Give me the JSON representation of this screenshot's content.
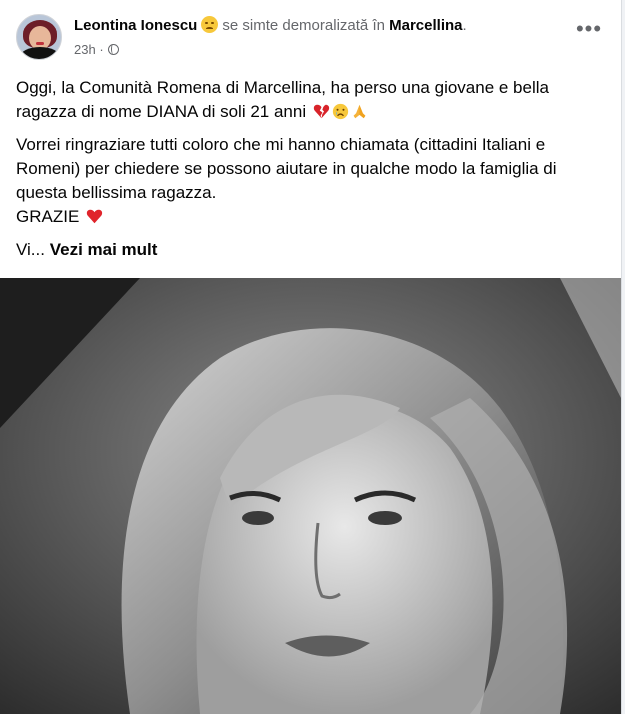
{
  "post": {
    "author": "Leontina Ionescu",
    "feeling": "se simte demoralizată",
    "in_word": "în",
    "location": "Marcellina",
    "location_suffix": ".",
    "timestamp": "23h",
    "more_label": "•••",
    "paragraph1": "Oggi, la Comunità Romena di Marcellina, ha perso una giovane e bella ragazza di nome DIANA di soli 21 anni",
    "paragraph2": "Vorrei ringraziare tutti coloro che mi hanno chiamata (cittadini Italiani e Romeni) per chiedere se possono aiutare in qualche modo la famiglia di questa bellissima ragazza.",
    "paragraph3": "GRAZIE",
    "see_more_prefix": "Vi...",
    "see_more_label": "Vezi mai mult"
  },
  "icons": {
    "feeling": "disappointed-face-emoji",
    "privacy": "globe-icon",
    "p1_emojis": [
      "broken-heart-emoji",
      "crying-face-emoji",
      "folded-hands-emoji"
    ],
    "p3_emoji": "red-heart-emoji"
  },
  "colors": {
    "text_primary": "#050505",
    "text_secondary": "#65676b",
    "card_bg": "#ffffff",
    "page_bg": "#f0f2f5"
  }
}
